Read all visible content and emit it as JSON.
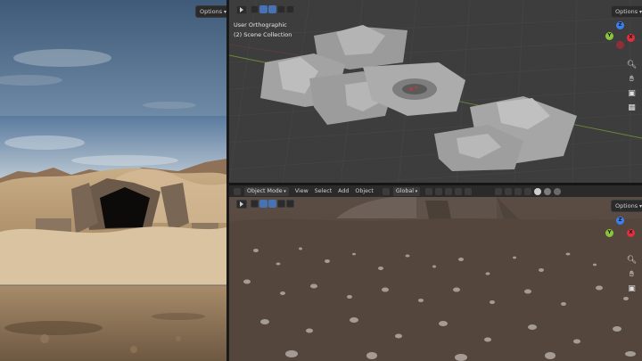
{
  "left_viewport": {
    "options_label": "Options"
  },
  "top_viewport": {
    "view_name": "User Orthographic",
    "collection": "(2) Scene Collection",
    "options_label": "Options"
  },
  "bottom_header": {
    "mode": "Object Mode",
    "menus": [
      "View",
      "Select",
      "Add",
      "Object"
    ],
    "transform_orientation": "Global"
  },
  "bottom_viewport": {
    "options_label": "Options"
  },
  "gizmo_axes": {
    "x_label": "X",
    "y_label": "Y",
    "z_label": "Z",
    "x_color": "#e0303f",
    "y_color": "#8bc43a",
    "z_color": "#3a7ff0"
  }
}
